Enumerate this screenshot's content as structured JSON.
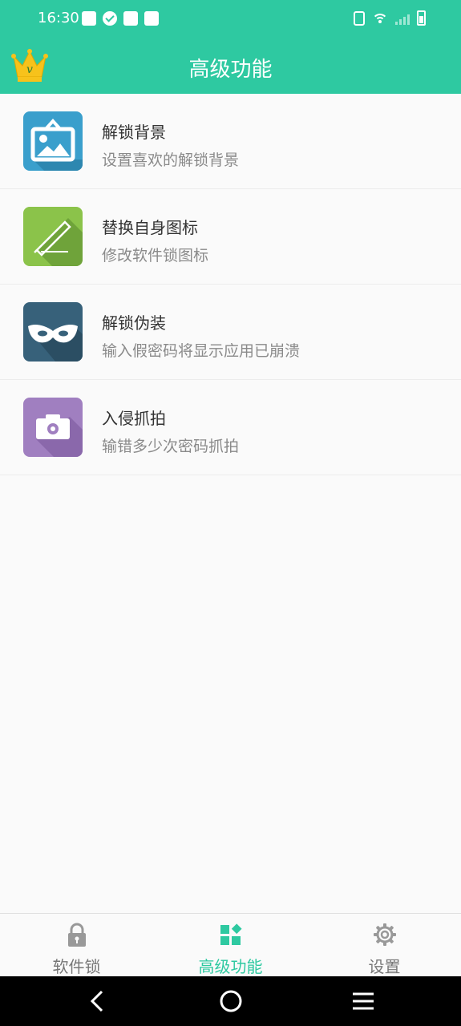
{
  "status": {
    "time": "16:30"
  },
  "header": {
    "title": "高级功能",
    "crown_icon": "vip-crown-icon"
  },
  "features": [
    {
      "title": "解锁背景",
      "desc": "设置喜欢的解锁背景",
      "icon": "image-icon",
      "color": "#3a9fcc"
    },
    {
      "title": "替换自身图标",
      "desc": "修改软件锁图标",
      "icon": "pencil-icon",
      "color": "#8bc34a"
    },
    {
      "title": "解锁伪装",
      "desc": "输入假密码将显示应用已崩溃",
      "icon": "mask-icon",
      "color": "#37617a"
    },
    {
      "title": "入侵抓拍",
      "desc": "输错多少次密码抓拍",
      "icon": "camera-icon",
      "color": "#a07fc0"
    }
  ],
  "bottom_nav": [
    {
      "label": "软件锁",
      "icon": "lock-icon",
      "active": false
    },
    {
      "label": "高级功能",
      "icon": "grid-icon",
      "active": true
    },
    {
      "label": "设置",
      "icon": "gear-icon",
      "active": false
    }
  ],
  "colors": {
    "accent": "#2ec9a1",
    "inactive": "#777777"
  }
}
